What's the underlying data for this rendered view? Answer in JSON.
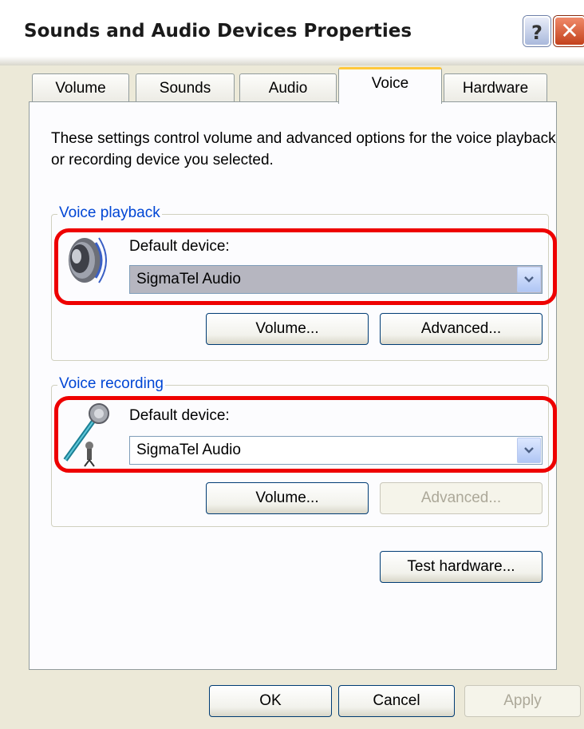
{
  "window": {
    "title": "Sounds and Audio Devices Properties"
  },
  "title_buttons": {
    "help_label": "?",
    "close_label": "✕"
  },
  "tabs": [
    {
      "label": "Volume",
      "active": false
    },
    {
      "label": "Sounds",
      "active": false
    },
    {
      "label": "Audio",
      "active": false
    },
    {
      "label": "Voice",
      "active": true
    },
    {
      "label": "Hardware",
      "active": false
    }
  ],
  "intro_text": "These settings control volume and advanced options for the voice playback or recording device you selected.",
  "voice_playback": {
    "legend": "Voice playback",
    "icon": "speaker-icon",
    "default_device_label": "Default device:",
    "device_value": "SigmaTel Audio",
    "volume_button": "Volume...",
    "advanced_button": "Advanced..."
  },
  "voice_recording": {
    "legend": "Voice recording",
    "icon": "microphone-icon",
    "default_device_label": "Default device:",
    "device_value": "SigmaTel Audio",
    "volume_button": "Volume...",
    "advanced_button": "Advanced...",
    "advanced_disabled": true
  },
  "test_hardware_button": "Test hardware...",
  "footer": {
    "ok": "OK",
    "cancel": "Cancel",
    "apply": "Apply"
  },
  "colors": {
    "highlight": "#ee0000",
    "legend_text": "#0046d5",
    "active_tab_accent": "#ffc83c"
  }
}
